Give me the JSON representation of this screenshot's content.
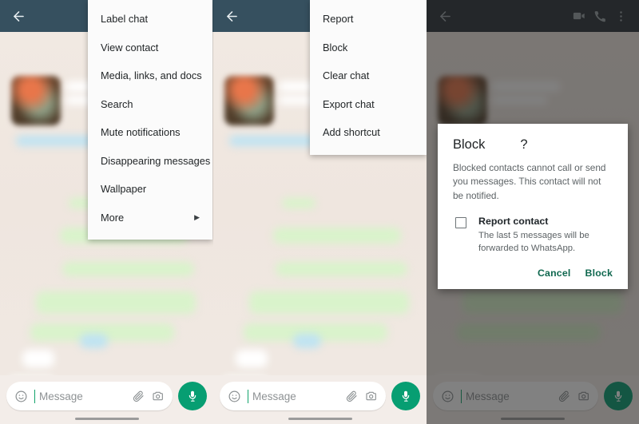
{
  "app": {
    "name": "WhatsApp"
  },
  "panels": [
    {
      "id": "panel-chat-menu",
      "header": {
        "back_icon": "arrow-left-icon"
      },
      "menu": {
        "items": [
          {
            "label": "Label chat",
            "has_submenu": false
          },
          {
            "label": "View contact",
            "has_submenu": false
          },
          {
            "label": "Media, links, and docs",
            "has_submenu": false
          },
          {
            "label": "Search",
            "has_submenu": false
          },
          {
            "label": "Mute notifications",
            "has_submenu": false
          },
          {
            "label": "Disappearing messages",
            "has_submenu": false
          },
          {
            "label": "Wallpaper",
            "has_submenu": false
          },
          {
            "label": "More",
            "has_submenu": true,
            "submenu_arrow": "▶"
          }
        ]
      },
      "composer": {
        "emoji_icon": "emoji-smiley-icon",
        "placeholder": "Message",
        "attach_icon": "paperclip-icon",
        "camera_icon": "camera-icon",
        "mic_icon": "microphone-icon"
      }
    },
    {
      "id": "panel-more-menu",
      "header": {
        "back_icon": "arrow-left-icon"
      },
      "menu": {
        "items": [
          {
            "label": "Report",
            "has_submenu": false
          },
          {
            "label": "Block",
            "has_submenu": false
          },
          {
            "label": "Clear chat",
            "has_submenu": false
          },
          {
            "label": "Export chat",
            "has_submenu": false
          },
          {
            "label": "Add shortcut",
            "has_submenu": false
          }
        ]
      },
      "composer": {
        "emoji_icon": "emoji-smiley-icon",
        "placeholder": "Message",
        "attach_icon": "paperclip-icon",
        "camera_icon": "camera-icon",
        "mic_icon": "microphone-icon"
      }
    },
    {
      "id": "panel-block-dialog",
      "header": {
        "back_icon": "arrow-left-icon",
        "video_call_icon": "video-camera-icon",
        "voice_call_icon": "phone-icon",
        "overflow_icon": "more-vertical-icon"
      },
      "dialog": {
        "title_prefix": "Block",
        "title_suffix": "?",
        "body": "Blocked contacts cannot call or send you messages. This contact will not be notified.",
        "checkbox": {
          "checked": false,
          "label": "Report contact",
          "description": "The last 5 messages will be forwarded to WhatsApp."
        },
        "cancel_label": "Cancel",
        "confirm_label": "Block"
      },
      "composer": {
        "emoji_icon": "emoji-smiley-icon",
        "placeholder": "Message",
        "attach_icon": "paperclip-icon",
        "camera_icon": "camera-icon",
        "mic_icon": "microphone-icon"
      }
    }
  ],
  "colors": {
    "appbar": "#36505f",
    "appbar_dim": "#2c3339",
    "wallpaper": "#efe7e0",
    "outgoing_bubble": "#d9f3cb",
    "accent_green": "#079e72",
    "dialog_action": "#10684f",
    "scrim": "rgba(30,30,30,0.56)"
  }
}
